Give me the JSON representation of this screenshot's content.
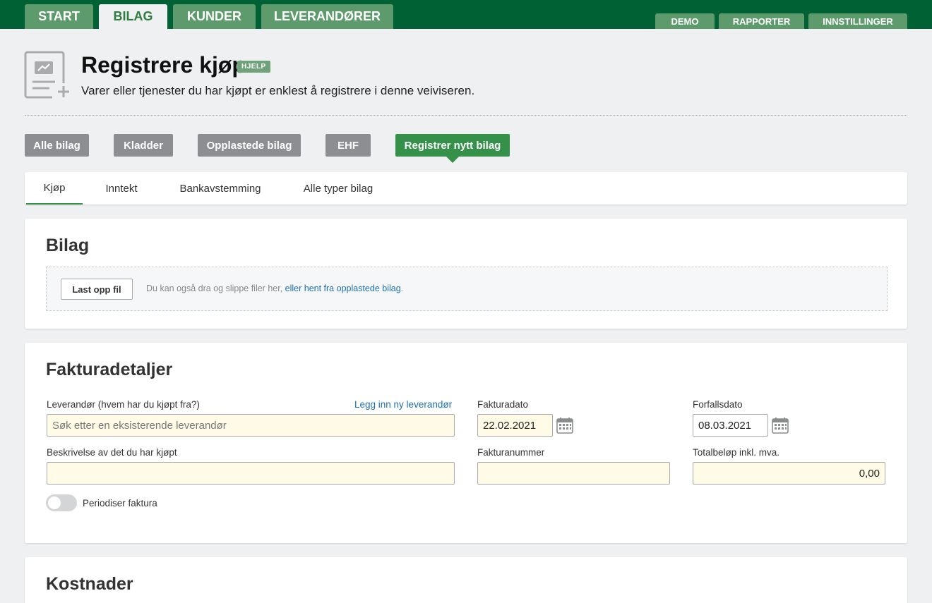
{
  "main_tabs": [
    {
      "label": "START"
    },
    {
      "label": "BILAG"
    },
    {
      "label": "KUNDER"
    },
    {
      "label": "LEVERANDØRER"
    }
  ],
  "right_tabs": [
    {
      "label": "DEMO"
    },
    {
      "label": "RAPPORTER"
    },
    {
      "label": "INNSTILLINGER"
    }
  ],
  "header": {
    "title": "Registrere kjøp",
    "help_badge": "HJELP",
    "subtitle": "Varer eller tjenester du har kjøpt er enklest å registrere i denne veiviseren.",
    "icon": "receipt-add-icon"
  },
  "view_buttons": [
    {
      "label": "Alle bilag"
    },
    {
      "label": "Kladder"
    },
    {
      "label": "Opplastede bilag"
    },
    {
      "label": "EHF"
    },
    {
      "label": "Registrer nytt bilag"
    }
  ],
  "subtabs": [
    {
      "label": "Kjøp"
    },
    {
      "label": "Inntekt"
    },
    {
      "label": "Bankavstemming"
    },
    {
      "label": "Alle typer bilag"
    }
  ],
  "bilag": {
    "title": "Bilag",
    "upload_button": "Last opp fil",
    "drop_hint": "Du kan også dra og slippe filer her, ",
    "drop_link": "eller hent fra opplastede bilag",
    "drop_hint_end": "."
  },
  "faktura": {
    "title": "Fakturadetaljer",
    "supplier_label": "Leverandør (hvem har du kjøpt fra?)",
    "new_supplier_link": "Legg inn ny leverandør",
    "supplier_placeholder": "Søk etter en eksisterende leverandør",
    "invoice_date_label": "Fakturadato",
    "invoice_date": "22.02.2021",
    "due_date_label": "Forfallsdato",
    "due_date": "08.03.2021",
    "description_label": "Beskrivelse av det du har kjøpt",
    "description_value": "",
    "invoice_number_label": "Fakturanummer",
    "invoice_number_value": "",
    "total_label": "Totalbeløp inkl. mva.",
    "total_value": "0,00",
    "periodize_label": "Periodiser faktura"
  },
  "kostnader": {
    "title": "Kostnader"
  },
  "colors": {
    "brand_dark": "#006135",
    "tab_green": "#5d9a6c",
    "accent_green": "#35914a",
    "input_bg": "#fffbe6",
    "link": "#1f6fb2"
  }
}
